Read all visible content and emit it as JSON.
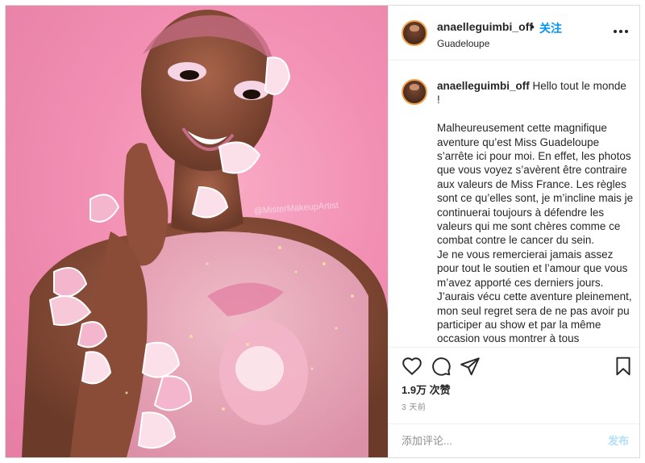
{
  "post": {
    "username": "anaelleguimbi_off",
    "separator": "•",
    "follow_label": "关注",
    "location": "Guadeloupe",
    "caption_username": "anaelleguimbi_off",
    "caption_text": " Hello tout le monde\n!\n\nMalheureusement cette magnifique aventure qu’est Miss Guadeloupe s’arrête ici pour moi. En effet, les photos que vous voyez s’avèrent être contraire aux valeurs de Miss France. Les règles sont ce qu’elles sont, je m’incline mais je continuerai toujours à défendre les valeurs qui me sont chères comme ce combat contre le cancer du sein.\nJe ne vous remercierai jamais assez pour tout le soutien et l’amour que vous m’avez apporté ces derniers jours. J’aurais vécu cette aventure pleinement, mon seul regret sera de ne pas avoir pu participer au show et par la même occasion vous montrer à tous",
    "likes": "1.9万 次赞",
    "time_ago": "3 天前",
    "comment_placeholder": "添加评论...",
    "post_button": "发布",
    "photo_watermark": "@MisterMakeupArtist",
    "icons": {
      "like": "heart-icon",
      "comment": "comment-icon",
      "share": "share-icon",
      "save": "bookmark-icon",
      "more": "more-options-icon"
    },
    "colors": {
      "accent": "#0095f6",
      "post_disabled": "#b2dffc",
      "photo_background": "#f28fb3"
    }
  }
}
